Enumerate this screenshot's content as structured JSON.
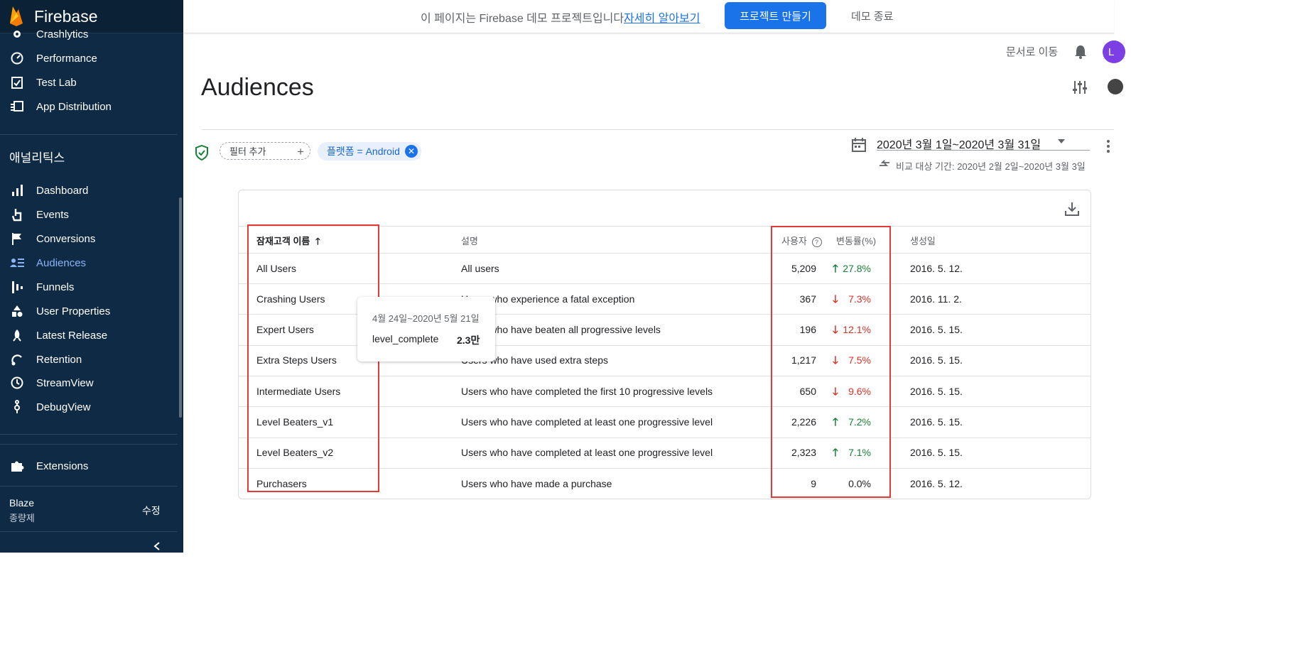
{
  "sidebar": {
    "brand": "Firebase",
    "top_items": [
      {
        "label": "Crashlytics",
        "icon": "crashlytics-icon"
      },
      {
        "label": "Performance",
        "icon": "performance-icon"
      },
      {
        "label": "Test Lab",
        "icon": "test-lab-icon"
      },
      {
        "label": "App Distribution",
        "icon": "app-distribution-icon"
      }
    ],
    "section_title": "애널리틱스",
    "analytics_items": [
      {
        "label": "Dashboard",
        "icon": "dashboard-icon"
      },
      {
        "label": "Events",
        "icon": "events-icon"
      },
      {
        "label": "Conversions",
        "icon": "flag-icon"
      },
      {
        "label": "Audiences",
        "icon": "audiences-icon",
        "active": true
      },
      {
        "label": "Funnels",
        "icon": "funnels-icon"
      },
      {
        "label": "User Properties",
        "icon": "user-properties-icon"
      },
      {
        "label": "Latest Release",
        "icon": "rocket-icon"
      },
      {
        "label": "Retention",
        "icon": "retention-icon"
      },
      {
        "label": "StreamView",
        "icon": "clock-icon"
      },
      {
        "label": "DebugView",
        "icon": "debug-icon"
      }
    ],
    "extensions": "Extensions",
    "plan_name": "Blaze",
    "plan_sub": "종량제",
    "plan_edit": "수정"
  },
  "banner": {
    "text": "이 페이지는 Firebase 데모 프로젝트입니다.",
    "link": "자세히 알아보기",
    "button": "프로젝트 만들기",
    "exit": "데모 종료"
  },
  "header": {
    "docs_link": "문서로 이동",
    "avatar_letter": "L",
    "title": "Audiences"
  },
  "filters": {
    "add_filter": "필터 추가",
    "chip": "플랫폼 = Android",
    "date_range": "2020년 3월 1일~2020년 3월 31일",
    "compare": "비교 대상 기간: 2020년 2월 2일~2020년 3월 3일"
  },
  "table": {
    "headers": {
      "name": "잠재고객 이름",
      "description": "설명",
      "users": "사용자",
      "change": "변동률(%)",
      "created": "생성일"
    },
    "rows": [
      {
        "name": "All Users",
        "description": "All users",
        "users": "5,209",
        "dir": "up",
        "change": "27.8%",
        "created": "2016. 5. 12."
      },
      {
        "name": "Crashing Users",
        "description": "Users who experience a fatal exception",
        "users": "367",
        "dir": "down",
        "change": "7.3%",
        "created": "2016. 11. 2."
      },
      {
        "name": "Expert Users",
        "description": "Users who have beaten all progressive levels",
        "users": "196",
        "dir": "down",
        "change": "12.1%",
        "created": "2016. 5. 15."
      },
      {
        "name": "Extra Steps Users",
        "description": "Users who have used extra steps",
        "users": "1,217",
        "dir": "down",
        "change": "7.5%",
        "created": "2016. 5. 15."
      },
      {
        "name": "Intermediate Users",
        "description": "Users who have completed the first 10 progressive levels",
        "users": "650",
        "dir": "down",
        "change": "9.6%",
        "created": "2016. 5. 15."
      },
      {
        "name": "Level Beaters_v1",
        "description": "Users who have completed at least one progressive level",
        "users": "2,226",
        "dir": "up",
        "change": "7.2%",
        "created": "2016. 5. 15."
      },
      {
        "name": "Level Beaters_v2",
        "description": "Users who have completed at least one progressive level",
        "users": "2,323",
        "dir": "up",
        "change": "7.1%",
        "created": "2016. 5. 15."
      },
      {
        "name": "Purchasers",
        "description": "Users who have made a purchase",
        "users": "9",
        "dir": "none",
        "change": "0.0%",
        "created": "2016. 5. 12."
      }
    ]
  },
  "tooltip": {
    "date": "4월 24일~2020년 5월 21일",
    "key": "level_complete",
    "value": "2.3만"
  },
  "colors": {
    "sidebar_bg": "#0f2a44",
    "accent": "#1a73e8",
    "up": "#188038",
    "down": "#d93025",
    "highlight": "#e53935"
  }
}
